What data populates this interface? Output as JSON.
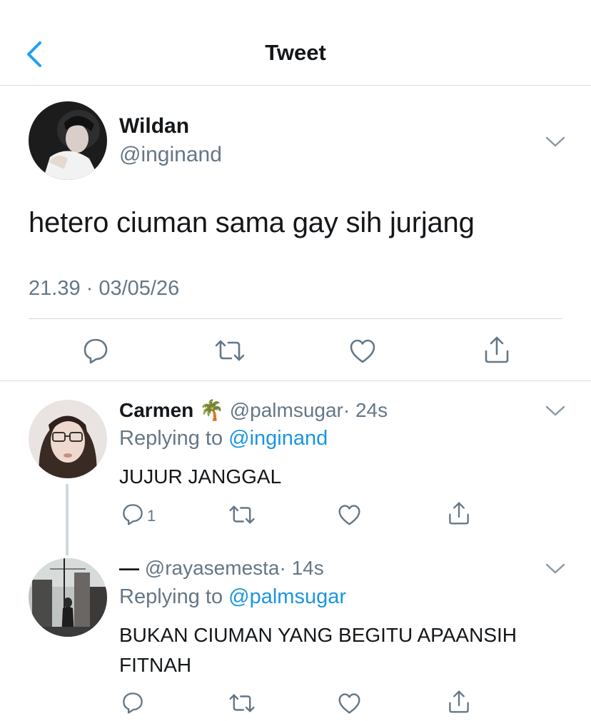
{
  "header": {
    "title": "Tweet",
    "back_icon": "chevron-left-icon",
    "accent": "#1da1f2"
  },
  "main_tweet": {
    "name": "Wildan",
    "handle": "@inginand",
    "text": "hetero ciuman sama gay sih jurjang",
    "timestamp": "21.39 · 03/05/26",
    "actions": [
      "reply-icon",
      "retweet-icon",
      "like-icon",
      "share-icon"
    ]
  },
  "replies": [
    {
      "name": "Carmen",
      "emoji": "🌴",
      "handle": "@palmsugar",
      "time": "· 24s",
      "replying_prefix": "Replying to",
      "replying_to": "@inginand",
      "text": "JUJUR JANGGAL",
      "reply_count": "1"
    },
    {
      "name": "—",
      "handle": "@rayasemesta",
      "time": "· 14s",
      "replying_prefix": "Replying to",
      "replying_to": "@palmsugar",
      "text": "BUKAN CIUMAN YANG BEGITU APAANSIH FITNAH",
      "reply_count": ""
    }
  ],
  "colors": {
    "text": "#14171a",
    "secondary": "#657786",
    "link": "#1b95e0",
    "divider": "#d6dade"
  }
}
